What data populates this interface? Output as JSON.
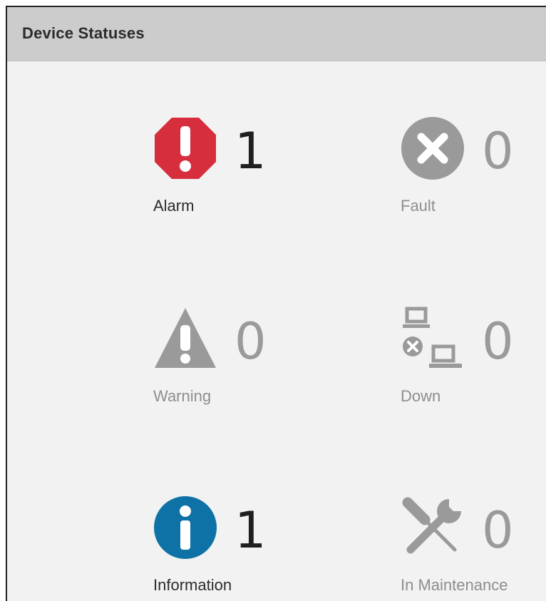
{
  "panel": {
    "title": "Device Statuses"
  },
  "statuses": {
    "alarm": {
      "label": "Alarm",
      "count": "1",
      "icon": "octagon-exclamation-icon",
      "color": "#d62e3d"
    },
    "fault": {
      "label": "Fault",
      "count": "0",
      "icon": "circle-x-icon",
      "color": "#9a9a9a"
    },
    "warning": {
      "label": "Warning",
      "count": "0",
      "icon": "triangle-exclamation-icon",
      "color": "#9a9a9a"
    },
    "down": {
      "label": "Down",
      "count": "0",
      "icon": "network-down-icon",
      "color": "#9a9a9a"
    },
    "information": {
      "label": "Information",
      "count": "1",
      "icon": "info-circle-icon",
      "color": "#0e72a6"
    },
    "maintenance": {
      "label": "In Maintenance",
      "count": "0",
      "icon": "tools-icon",
      "color": "#9a9a9a"
    }
  }
}
